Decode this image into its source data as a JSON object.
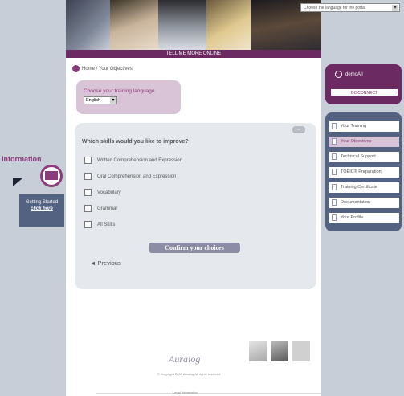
{
  "banner": {
    "tagline": "TELL ME MORE ONLINE",
    "language_select": "Choose the language for the portal"
  },
  "breadcrumb": "Home / Your Objectives",
  "training_language": {
    "label": "Choose your training language",
    "value": "English"
  },
  "skills": {
    "title": "Which skills would you like to improve?",
    "close": "...",
    "items": [
      {
        "label": "Written Comprehension and Expression",
        "checked": false
      },
      {
        "label": "Oral Comprehension and Expression",
        "checked": false
      },
      {
        "label": "Vocabulary",
        "checked": false
      },
      {
        "label": "Grammar",
        "checked": false
      },
      {
        "label": "All Skills",
        "checked": false
      }
    ],
    "confirm_label": "Confirm your choices",
    "previous_label": "Previous"
  },
  "user": {
    "name": "demoAll",
    "disconnect_label": "DISCONNECT"
  },
  "nav": {
    "items": [
      {
        "label": "Your Training",
        "active": false
      },
      {
        "label": "Your Objectives",
        "active": true
      },
      {
        "label": "Technical Support",
        "active": false
      },
      {
        "label": "TOEIC® Preparation",
        "active": false
      },
      {
        "label": "Training Certificate",
        "active": false
      },
      {
        "label": "Documentation",
        "active": false
      },
      {
        "label": "Your Profile",
        "active": false
      }
    ]
  },
  "info": {
    "title": "Information",
    "getting_started": "Getting Started",
    "click_here": "click here"
  },
  "footer": {
    "logo": "Auralog",
    "copyright": "© Copyright 2009 Auralog All rights reserved",
    "link": "Legal Information"
  },
  "colors": {
    "accent": "#6b2a61",
    "nav_bg": "#546282",
    "side_bg": "#c8ced7",
    "panel_bg": "#e5e8ed"
  }
}
